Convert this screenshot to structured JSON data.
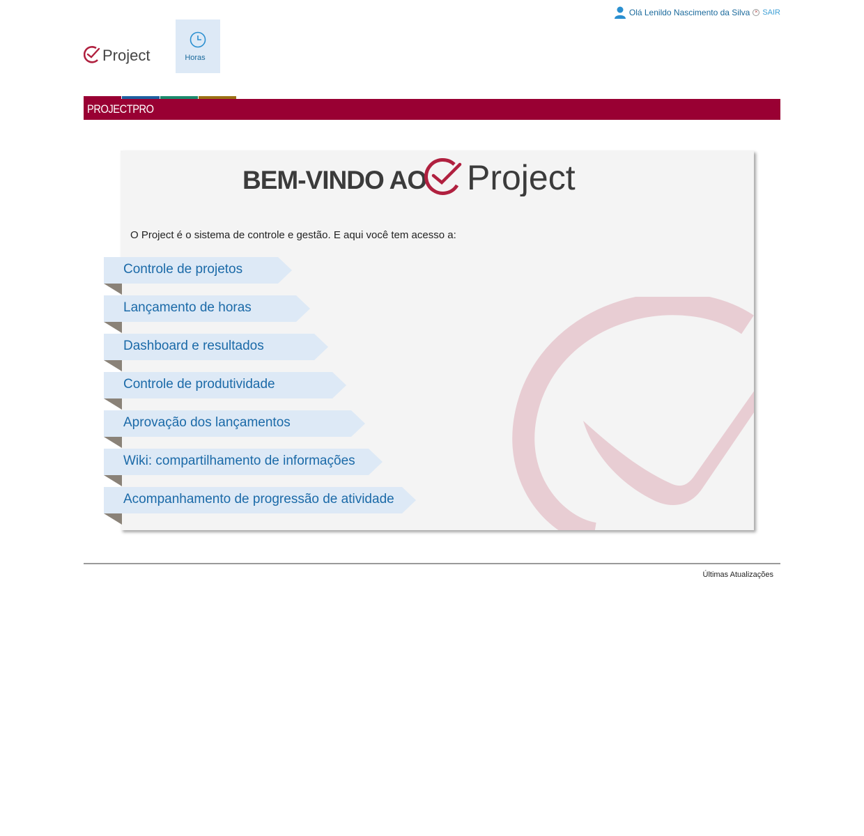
{
  "header": {
    "user_greeting": "Olá Lenildo Nascimento da Silva",
    "logout_label": "SAIR",
    "logo_text": "Project"
  },
  "nav": {
    "tiles": [
      {
        "label": "Horas",
        "icon": "clock-icon"
      }
    ]
  },
  "section": {
    "title": "PROJECTPRO",
    "strip_colors": [
      "#990033",
      "#1d5fa0",
      "#1b8a6c",
      "#9b6f12"
    ]
  },
  "welcome": {
    "heading": "BEM-VINDO AO",
    "logo_text": "Project",
    "intro": "O Project é o sistema de controle e gestão. E aqui você tem acesso a:",
    "features": [
      "Controle de projetos",
      "Lançamento de horas",
      "Dashboard e resultados",
      "Controle de produtividade",
      "Aprovação dos lançamentos",
      "Wiki: compartilhamento de informações",
      "Acompanhamento de progressão de atividade"
    ]
  },
  "footer": {
    "updates_link": "Últimas Atualizações"
  },
  "colors": {
    "brand": "#990033",
    "link": "#1b6a9c",
    "ribbon": "#dde9f6"
  }
}
